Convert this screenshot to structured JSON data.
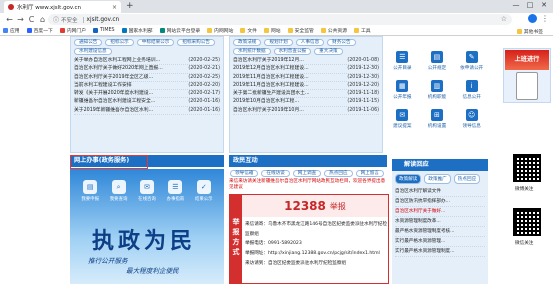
{
  "browser": {
    "tab_title": "水利厅 www.xjslt.gov.cn",
    "new_tab": "+",
    "close_tab": "×",
    "window_controls": [
      "—",
      "□",
      "✕"
    ],
    "nav": {
      "back": "←",
      "forward": "→",
      "reload": "C",
      "home": "⌂"
    },
    "security_label": "不安全",
    "url": "xjslt.gov.cn",
    "bookmarks": [
      "应用",
      "百度一下",
      "内网门户",
      "TIMES",
      "国家水利部",
      "网站云平台登录",
      "内网网站",
      "文件",
      "网站",
      "安全监管",
      "公共资源",
      "工具"
    ],
    "bookmarks_right": "其他书签",
    "colors": {
      "accent": "#1a73e8"
    }
  },
  "panel_left": {
    "tab_label": "",
    "chips": [
      "通知公告",
      "招标公示",
      "中标结果公示",
      "招标采购公告",
      "水利建设信息"
    ],
    "news": [
      {
        "title": "关于举办自治区水利工程网上业务培训...",
        "date": "(2020-02-25)"
      },
      {
        "title": "自治区水利厅关于做好2020年网上直报...",
        "date": "(2020-02-21)"
      },
      {
        "title": "自治区水利厅关于2019年全区乙级...",
        "date": "(2020-02-25)"
      },
      {
        "title": "当前水利工程建设工作安排",
        "date": "(2020-02-20)"
      },
      {
        "title": "转发《关于开展2020年度水利建设...",
        "date": "(2020-02-17)"
      },
      {
        "title": "新疆维吾尔自治区水利建设工程安全...",
        "date": "(2020-01-16)"
      },
      {
        "title": "关于2019年新疆维吾尔自治区水利...",
        "date": "(2020-01-16)"
      }
    ]
  },
  "panel_mid": {
    "chips": [
      "政策法规",
      "规划计划",
      "人事信息",
      "财务公告",
      "水利统计数据",
      "水利普查公报",
      "重大决策"
    ],
    "news": [
      {
        "title": "自治区水利厅关于2019年12月...",
        "date": "(2020-01-08)"
      },
      {
        "title": "2019年12月自治区水利工程建设...",
        "date": "(2019-12-30)"
      },
      {
        "title": "2019年11月自治区水利工程建设...",
        "date": "(2019-12-30)"
      },
      {
        "title": "2019年11月自治区水利工程建设...",
        "date": "(2019-12-20)"
      },
      {
        "title": "关于第二批新疆生产建设兵团水土...",
        "date": "(2019-11-18)"
      },
      {
        "title": "2019年10月自治区水利工程...",
        "date": "(2019-11-15)"
      },
      {
        "title": "自治区水利厅关于2019年10月...",
        "date": "(2019-11-06)"
      }
    ]
  },
  "icon_grid": [
    {
      "label": "公开目录",
      "icon": "list-icon"
    },
    {
      "label": "公开规定",
      "icon": "document-icon"
    },
    {
      "label": "依申请公开",
      "icon": "edit-icon"
    },
    {
      "label": "公开年报",
      "icon": "calendar-icon"
    },
    {
      "label": "机构职能",
      "icon": "building-icon"
    },
    {
      "label": "信息公开",
      "icon": "info-icon"
    },
    {
      "label": "建议提案",
      "icon": "chat-icon"
    },
    {
      "label": "机构设置",
      "icon": "tree-icon"
    },
    {
      "label": "领导信息",
      "icon": "person-icon"
    },
    {
      "label": "",
      "icon": "mail-icon"
    },
    {
      "label": "",
      "icon": "stats-icon"
    },
    {
      "label": "",
      "icon": "help-icon"
    }
  ],
  "section_online": {
    "title": "网上办事(政务服务)",
    "items": [
      "我要申报",
      "我要查询",
      "在线咨询",
      "办事指南",
      "结果公示"
    ],
    "calligraphy": "执政为民",
    "slogan_1": "推行公开服务",
    "slogan_2": "最大程度利企便民"
  },
  "section_interaction": {
    "title": "政民互动",
    "chips": [
      "领导信箱",
      "在线访谈",
      "网上调查",
      "热点回应",
      "网上留言"
    ],
    "red_notice": "来信来访请关注新疆维吾尔自治区水利厅网站政民互动栏目，欢迎各界提出意见建议",
    "report": {
      "side_text": "举报方式",
      "hotline": "12388",
      "hotline_word": "举报",
      "lines": [
        "来信请寄：乌鲁木齐市黑龙江路146号自治区纪委监委派驻水利厅纪检监察组",
        "举报电话：0991-5892023",
        "举报网址：http://xinjiang.12388.gov.cn/pcjg/sit/index1.html",
        "来访请到：自治区纪委监委派驻水利厅纪检监察组"
      ]
    }
  },
  "section_response": {
    "title": "解读回应",
    "tabs": [
      "政策解读",
      "政策推广",
      "热点回应"
    ],
    "items": [
      "自治区水利厅解读文件",
      "自治区防汛抗旱指挥部办...",
      "自治区水利厅关于做好...",
      "水资源管理制度改革...",
      "最严格水资源管理制度考核...",
      "实行最严格水资源管理...",
      "实行最严格水资源管理制度..."
    ],
    "red_index": 2
  },
  "right_column": {
    "ad_title": "上班进行",
    "qr_label_1": "微博关注",
    "qr_label_2": "微信关注"
  }
}
